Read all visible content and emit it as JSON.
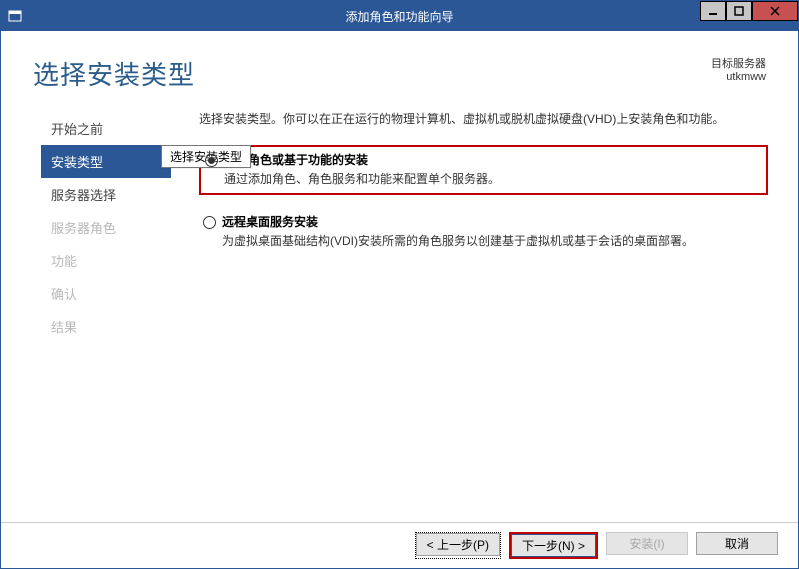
{
  "titlebar": {
    "title": "添加角色和功能向导"
  },
  "page_title": "选择安装类型",
  "target_server": {
    "label": "目标服务器",
    "name": "utkmww"
  },
  "sidebar": {
    "tooltip": "选择安装类型",
    "items": [
      {
        "label": "开始之前"
      },
      {
        "label": "安装类型"
      },
      {
        "label": "服务器选择"
      },
      {
        "label": "服务器角色"
      },
      {
        "label": "功能"
      },
      {
        "label": "确认"
      },
      {
        "label": "结果"
      }
    ]
  },
  "intro": "选择安装类型。你可以在正在运行的物理计算机、虚拟机或脱机虚拟硬盘(VHD)上安装角色和功能。",
  "options": {
    "role": {
      "title": "基于角色或基于功能的安装",
      "desc": "通过添加角色、角色服务和功能来配置单个服务器。"
    },
    "rds": {
      "title": "远程桌面服务安装",
      "desc": "为虚拟桌面基础结构(VDI)安装所需的角色服务以创建基于虚拟机或基于会话的桌面部署。"
    }
  },
  "footer": {
    "prev": "< 上一步(P)",
    "next": "下一步(N) >",
    "install": "安装(I)",
    "cancel": "取消"
  }
}
